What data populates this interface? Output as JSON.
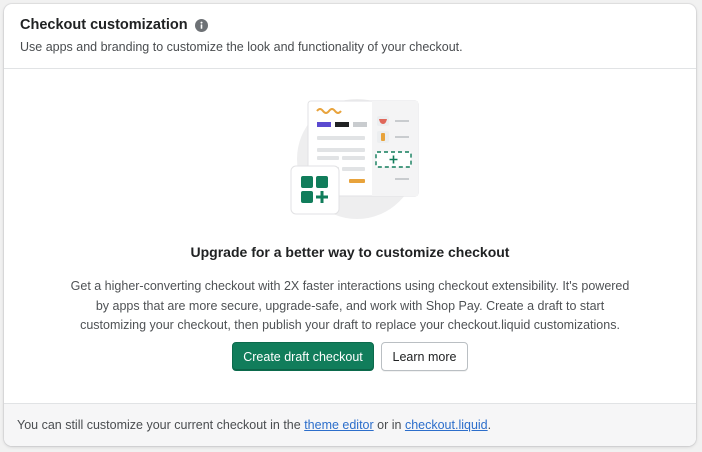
{
  "header": {
    "title": "Checkout customization",
    "subtitle": "Use apps and branding to customize the look and functionality of your checkout."
  },
  "main": {
    "heading": "Upgrade for a better way to customize checkout",
    "body": "Get a higher-converting checkout with 2X faster interactions using checkout extensibility. It's powered by apps that are more secure, upgrade-safe, and work with Shop Pay. Create a draft to start customizing your checkout, then publish your draft to replace your checkout.liquid customizations.",
    "primary_button": "Create draft checkout",
    "secondary_button": "Learn more"
  },
  "footer": {
    "text_before": "You can still customize your current checkout in the ",
    "link_theme_editor": "theme editor",
    "text_middle": " or in ",
    "link_checkout_liquid": "checkout.liquid",
    "text_after": "."
  },
  "icons": {
    "info": "info-icon",
    "illustration": "checkout-illustration",
    "app_blocks": "app-blocks-icon"
  },
  "colors": {
    "primary": "#117d5b",
    "link": "#2c6ecb",
    "footer_bg": "#f6f6f7"
  }
}
